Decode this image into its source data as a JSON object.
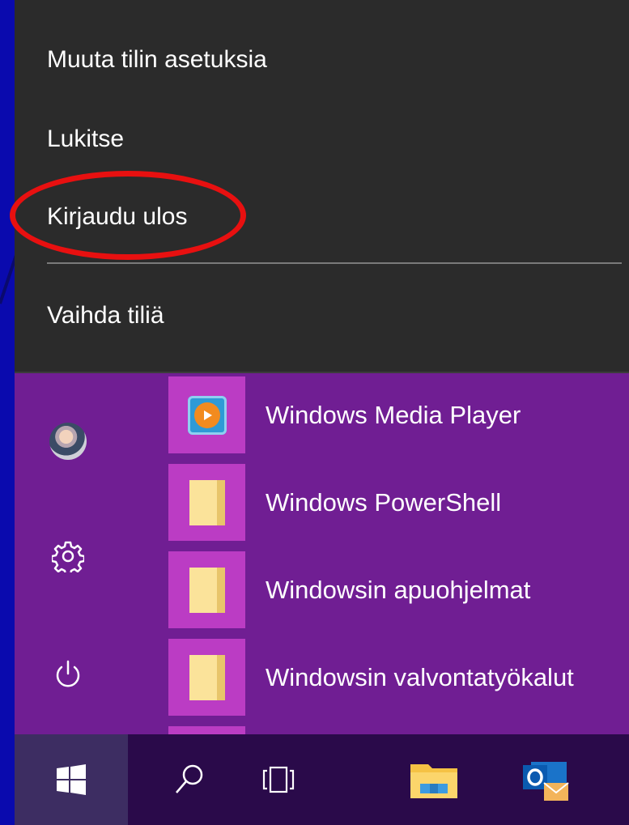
{
  "account_menu": {
    "items": [
      {
        "label": "Muuta tilin asetuksia"
      },
      {
        "label": "Lukitse"
      },
      {
        "label": "Kirjaudu ulos"
      },
      {
        "label": "Vaihda tiliä"
      }
    ]
  },
  "start_menu": {
    "rail": [
      {
        "icon": "user-avatar"
      },
      {
        "icon": "gear-icon"
      },
      {
        "icon": "power-icon"
      }
    ],
    "apps": [
      {
        "label": "Windows Media Player",
        "icon": "windows-media-player-icon"
      },
      {
        "label": "Windows PowerShell",
        "icon": "folder-icon"
      },
      {
        "label": "Windowsin apuohjelmat",
        "icon": "folder-icon"
      },
      {
        "label": "Windowsin valvontatyökalut",
        "icon": "folder-icon"
      }
    ]
  },
  "taskbar": {
    "buttons": [
      "windows-start-icon",
      "search-icon",
      "task-view-icon",
      "file-explorer-icon",
      "outlook-icon"
    ]
  },
  "colors": {
    "background": "#0a0aae",
    "menu_background": "#2b2b2b",
    "start_background": "#701e93",
    "tile": "#bb3cc4",
    "taskbar": "#2a0a4a",
    "highlight": "#e81010"
  }
}
